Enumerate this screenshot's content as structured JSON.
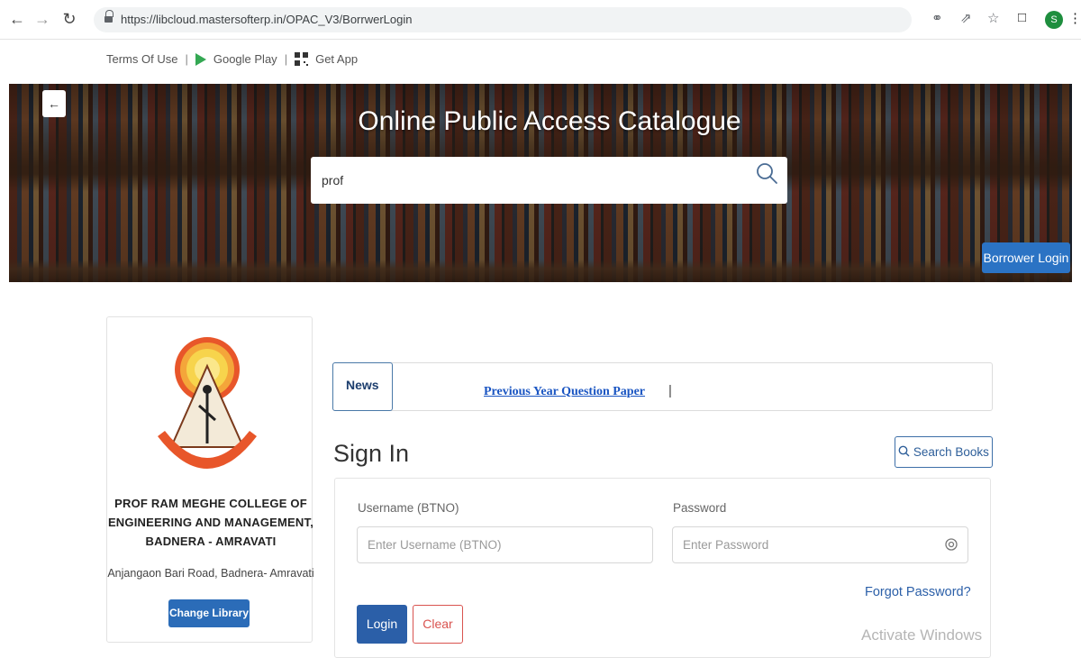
{
  "browser": {
    "url": "https://libcloud.mastersofterp.in/OPAC_V3/BorrwerLogin",
    "profile_initial": "S"
  },
  "toplinks": {
    "terms": "Terms Of Use",
    "separator": "|",
    "google_play": "Google Play",
    "get_app": "Get App"
  },
  "banner": {
    "title": "Online Public Access Catalogue",
    "search_value": "prof",
    "borrower_login": "Borrower Login"
  },
  "library": {
    "name_line1": "PROF RAM MEGHE COLLEGE OF",
    "name_line2": "ENGINEERING AND MANAGEMENT,",
    "name_line3": "BADNERA - AMRAVATI",
    "address": "Anjangaon Bari Road, Badnera- Amravati",
    "change_library": "Change Library"
  },
  "news": {
    "label": "News",
    "link": "Previous Year Question Paper",
    "pipe": "|"
  },
  "signin": {
    "title": "Sign In",
    "search_books": "Search Books",
    "username_label": "Username (BTNO)",
    "username_placeholder": "Enter Username (BTNO)",
    "password_label": "Password",
    "password_placeholder": "Enter Password",
    "forgot_password": "Forgot Password?",
    "login": "Login",
    "clear": "Clear"
  },
  "watermark": "Activate Windows",
  "colors": {
    "primary_blue": "#2b5fa8",
    "clear_red": "#d9534f",
    "borrower_blue": "#2b73c4"
  }
}
